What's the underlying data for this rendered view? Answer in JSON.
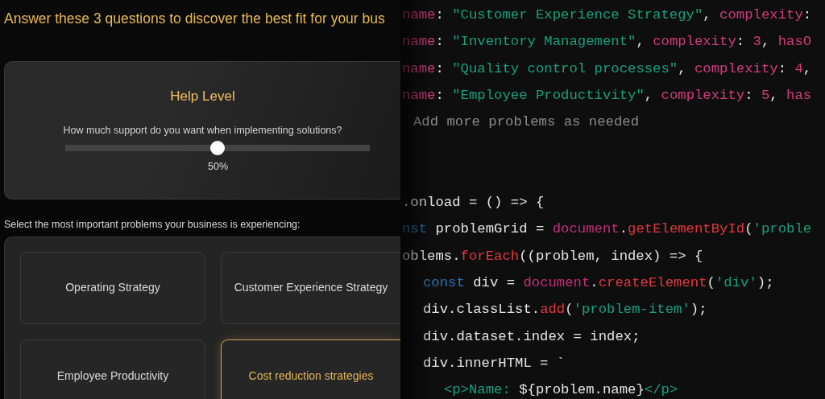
{
  "intro": "Answer these 3 questions to discover the best fit for your bus",
  "help_card": {
    "title": "Help Level",
    "question": "How much support do you want when implementing solutions?",
    "slider": {
      "level": 0.5,
      "reading": "50%"
    }
  },
  "problems_prompt": "Select the most important problems your business is experiencing:",
  "problems": [
    {
      "label": "Operating Strategy",
      "selected": false
    },
    {
      "label": "Customer Experience Strategy",
      "selected": false
    },
    {
      "label": "Employee Productivity",
      "selected": false
    },
    {
      "label": "Cost reduction strategies",
      "selected": true
    }
  ],
  "code_lines": [
    {
      "kind": "code",
      "tokens": [
        {
          "kind": "key",
          "text": "name"
        },
        {
          "kind": "plain",
          "text": ": "
        },
        {
          "kind": "string",
          "text": "\"Customer Experience Strategy\""
        },
        {
          "kind": "plain",
          "text": ", "
        },
        {
          "kind": "key",
          "text": "complexity"
        },
        {
          "kind": "plain",
          "text": ":"
        }
      ]
    },
    {
      "kind": "code",
      "tokens": [
        {
          "kind": "key",
          "text": "name"
        },
        {
          "kind": "plain",
          "text": ": "
        },
        {
          "kind": "string",
          "text": "\"Inventory Management\""
        },
        {
          "kind": "plain",
          "text": ", "
        },
        {
          "kind": "key",
          "text": "complexity"
        },
        {
          "kind": "plain",
          "text": ": "
        },
        {
          "kind": "number",
          "text": "3"
        },
        {
          "kind": "plain",
          "text": ", "
        },
        {
          "kind": "key",
          "text": "hasO"
        }
      ]
    },
    {
      "kind": "code",
      "tokens": [
        {
          "kind": "key",
          "text": "name"
        },
        {
          "kind": "plain",
          "text": ": "
        },
        {
          "kind": "string",
          "text": "\"Quality control processes\""
        },
        {
          "kind": "plain",
          "text": ", "
        },
        {
          "kind": "key",
          "text": "complexity"
        },
        {
          "kind": "plain",
          "text": ": "
        },
        {
          "kind": "number",
          "text": "4"
        },
        {
          "kind": "plain",
          "text": ","
        }
      ]
    },
    {
      "kind": "code",
      "tokens": [
        {
          "kind": "key",
          "text": "name"
        },
        {
          "kind": "plain",
          "text": ": "
        },
        {
          "kind": "string",
          "text": "\"Employee Productivity\""
        },
        {
          "kind": "plain",
          "text": ", "
        },
        {
          "kind": "key",
          "text": "complexity"
        },
        {
          "kind": "plain",
          "text": ": "
        },
        {
          "kind": "number",
          "text": "5"
        },
        {
          "kind": "plain",
          "text": ", "
        },
        {
          "kind": "key",
          "text": "has"
        }
      ]
    },
    {
      "kind": "code",
      "tokens": [
        {
          "kind": "comment",
          "text": "Add more problems as needed"
        }
      ]
    },
    {
      "kind": "blank"
    },
    {
      "kind": "blank"
    },
    {
      "kind": "code",
      "tokens": [
        {
          "kind": "plain",
          "text": ".onload = () => {"
        }
      ]
    },
    {
      "kind": "code",
      "tokens": [
        {
          "kind": "keyword",
          "text": "nst"
        },
        {
          "kind": "plain",
          "text": " problemGrid = "
        },
        {
          "kind": "object",
          "text": "document"
        },
        {
          "kind": "plain",
          "text": "."
        },
        {
          "kind": "method",
          "text": "getElementById"
        },
        {
          "kind": "plain",
          "text": "("
        },
        {
          "kind": "string",
          "text": "'proble"
        }
      ]
    },
    {
      "kind": "code",
      "tokens": [
        {
          "kind": "plain",
          "text": "oblems."
        },
        {
          "kind": "method",
          "text": "forEach"
        },
        {
          "kind": "plain",
          "text": "((problem, index) => {"
        }
      ],
      "children": [
        {
          "kind": "code",
          "tokens": [
            {
              "kind": "keyword",
              "text": "const"
            },
            {
              "kind": "plain",
              "text": " div = "
            },
            {
              "kind": "object",
              "text": "document"
            },
            {
              "kind": "plain",
              "text": "."
            },
            {
              "kind": "method",
              "text": "createElement"
            },
            {
              "kind": "plain",
              "text": "("
            },
            {
              "kind": "string",
              "text": "'div'"
            },
            {
              "kind": "plain",
              "text": ");"
            }
          ]
        },
        {
          "kind": "code",
          "tokens": [
            {
              "kind": "plain",
              "text": "div.classList."
            },
            {
              "kind": "method",
              "text": "add"
            },
            {
              "kind": "plain",
              "text": "("
            },
            {
              "kind": "string",
              "text": "'problem-item'"
            },
            {
              "kind": "plain",
              "text": ");"
            }
          ]
        },
        {
          "kind": "code",
          "tokens": [
            {
              "kind": "plain",
              "text": "div.dataset.index = index;"
            }
          ]
        },
        {
          "kind": "code",
          "tokens": [
            {
              "kind": "plain",
              "text": "div.innerHTML = `"
            }
          ],
          "children": [
            {
              "kind": "code",
              "tokens": [
                {
                  "kind": "string",
                  "text": "<p>Name: "
                },
                {
                  "kind": "plain",
                  "text": "${problem.name}"
                },
                {
                  "kind": "string",
                  "text": "</p>"
                }
              ]
            }
          ]
        }
      ]
    }
  ]
}
